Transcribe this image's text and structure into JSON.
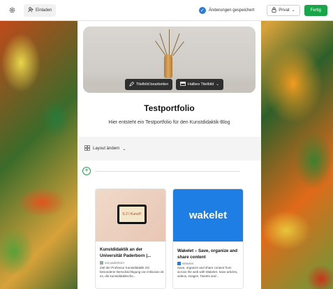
{
  "topbar": {
    "invite_label": "Einladen",
    "saved_status": "Änderungen gespeichert",
    "privacy_label": "Privat",
    "done_label": "Fertig"
  },
  "portfolio": {
    "cover_edit_label": "Titelbild bearbeiten",
    "cover_size_label": "Halbes Titelbild",
    "title": "Testportfolio",
    "subtitle": "Hier entsteht ein Testportfolio für den Kunstdidaktik-Blog"
  },
  "layout": {
    "change_label": "Layout ändern"
  },
  "cards": [
    {
      "title": "Kunstdidaktik an der Universität Paderborn |...",
      "source": "uni-paderborn",
      "description": "Ziel der Professur Kunstdidaktik mit besonderer Berücksichtigung von Inklusion ist es, die kunstdidaktische...",
      "thumb_text": "S 2 I Kunst!!"
    },
    {
      "title": "Wakelet – Save, organize and share content",
      "source": "Wakelet",
      "description": "Save, organize and share content from across the web with Wakelet. Save articles, videos, images, Tweets and...",
      "thumb_text": "wakelet"
    }
  ],
  "colors": {
    "accent_green": "#1aa54a",
    "saved_blue": "#2b7bd6",
    "wakelet_blue": "#1e7ee4"
  }
}
